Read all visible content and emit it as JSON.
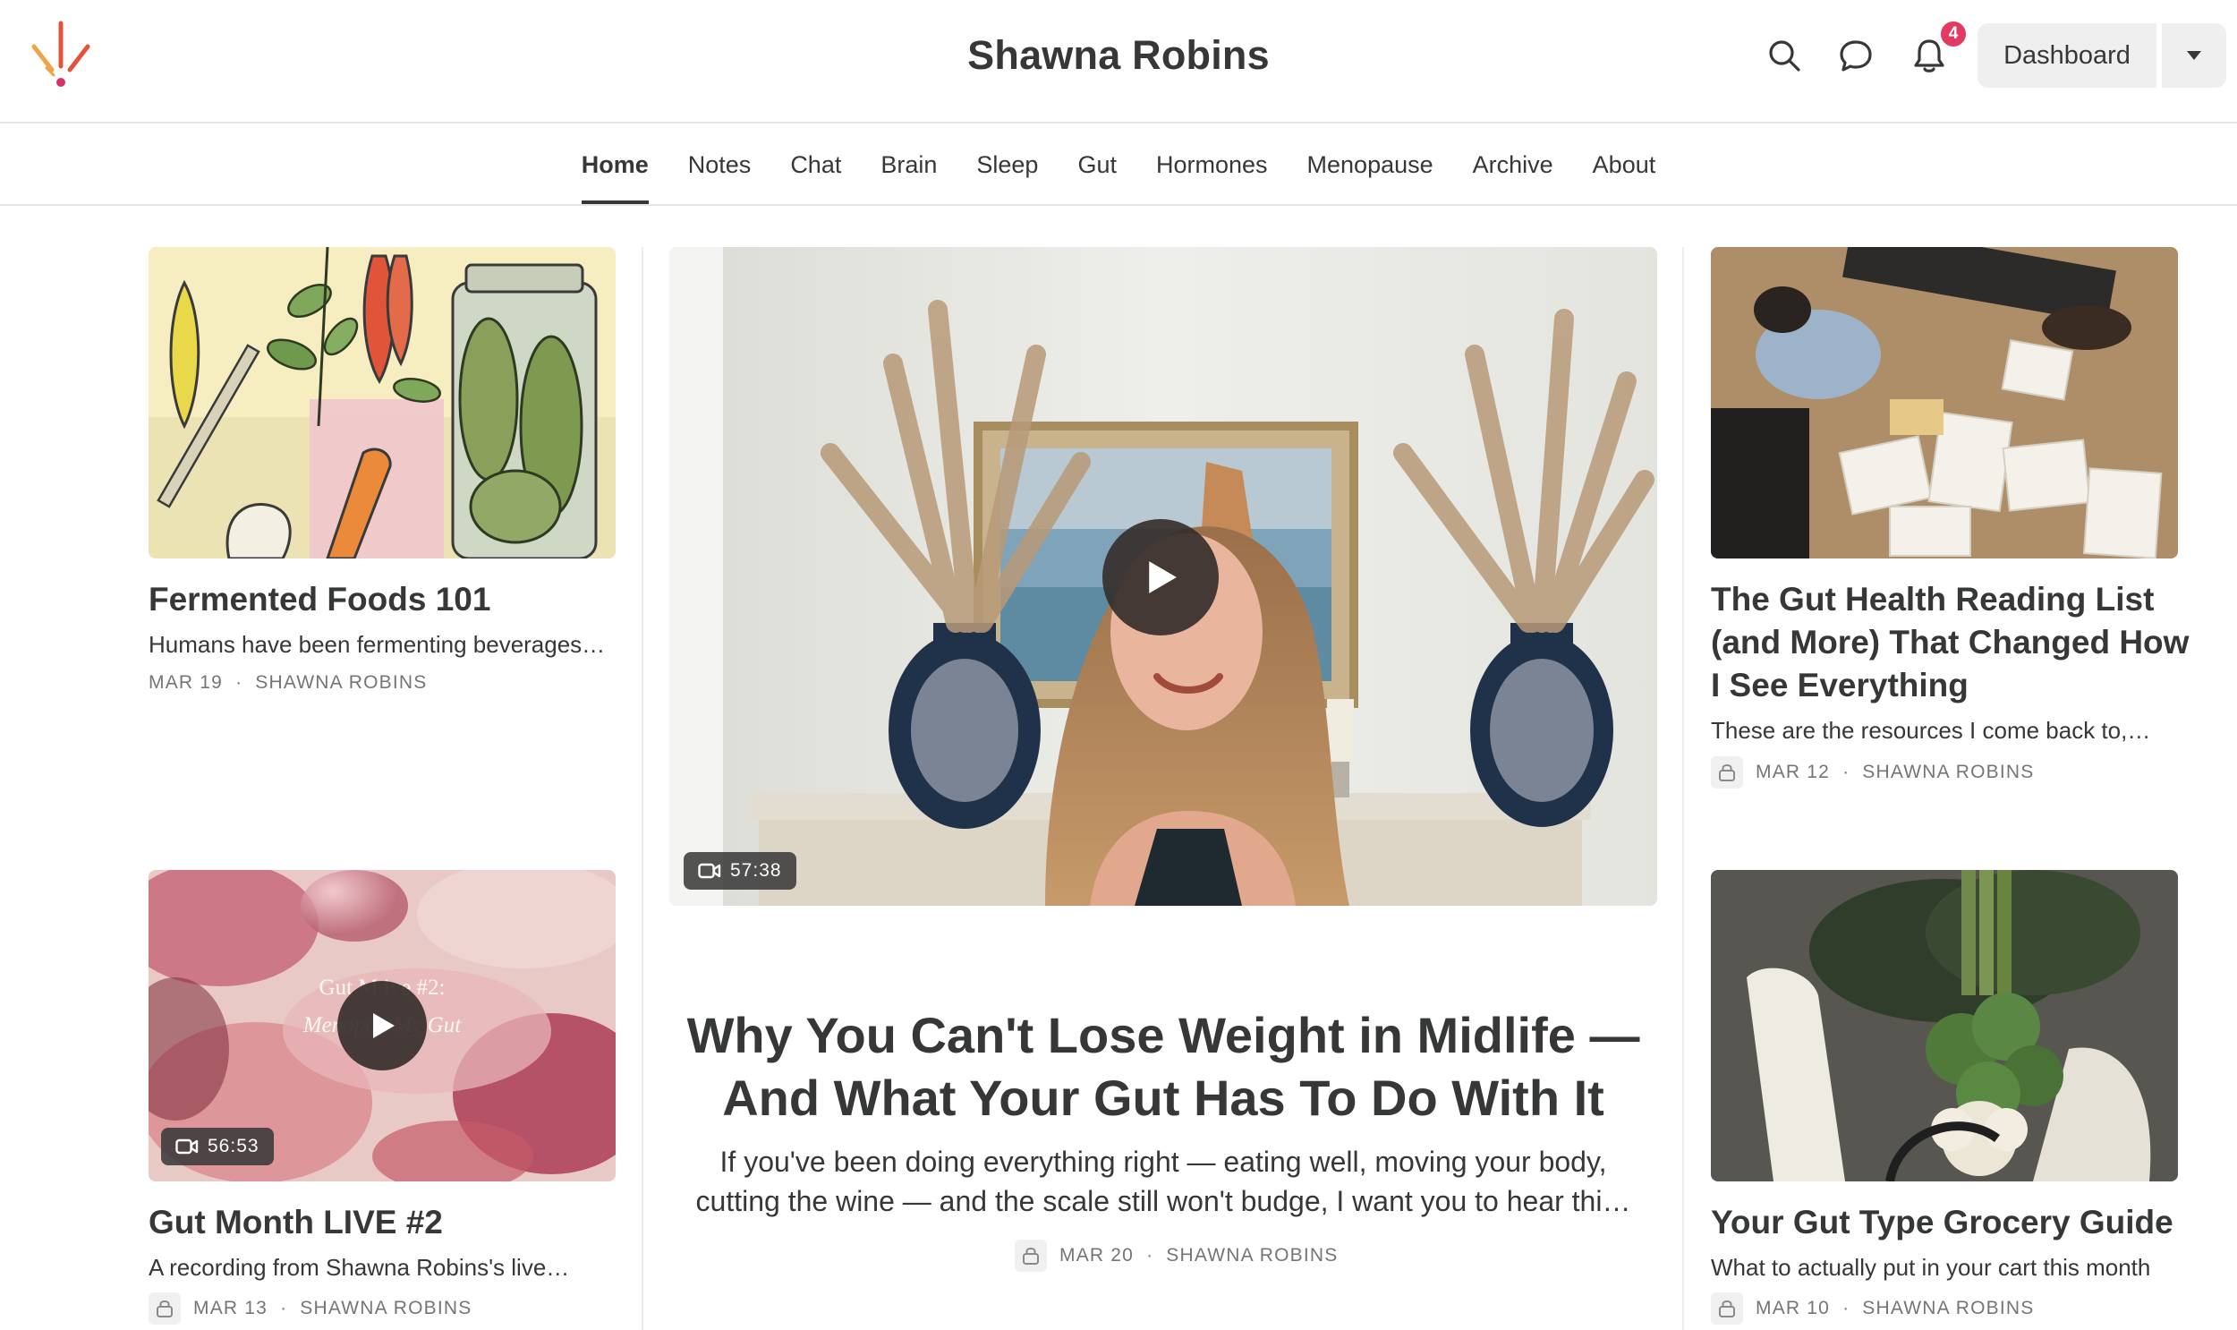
{
  "header": {
    "site_title": "Shawna Robins",
    "notification_count": "4",
    "dashboard_label": "Dashboard",
    "icons": [
      "logo-burst-icon",
      "search-icon",
      "chat-bubble-icon",
      "bell-icon",
      "caret-down-icon"
    ],
    "accent_colors": {
      "badge": "#e13a63",
      "logo_red": "#e4523b",
      "logo_orange": "#f0a24a",
      "logo_pink": "#d6306b"
    }
  },
  "nav": {
    "items": [
      "Home",
      "Notes",
      "Chat",
      "Brain",
      "Sleep",
      "Gut",
      "Hormones",
      "Menopause",
      "Archive",
      "About"
    ],
    "active": "Home"
  },
  "posts": {
    "fermented": {
      "title": "Fermented Foods 101",
      "subtitle": "Humans have been fermenting beverages…",
      "date": "MAR 19",
      "author": "SHAWNA ROBINS"
    },
    "featured": {
      "title": "Why You Can't Lose Weight in Midlife — And What Your Gut Has To Do With It",
      "subtitle": "If you've been doing everything right — eating well, moving your body, cutting the wine — and the scale still won't budge, I want you to hear thi…",
      "date": "MAR 20",
      "author": "SHAWNA ROBINS",
      "duration": "57:38",
      "locked": true
    },
    "reading_list": {
      "title": "The Gut Health Reading List (and More) That Changed How I See Everything",
      "subtitle": "These are the resources I come back to,…",
      "date": "MAR 12",
      "author": "SHAWNA ROBINS",
      "locked": true
    },
    "gut_live": {
      "title": "Gut Month LIVE #2",
      "subtitle": "A recording from Shawna Robins's live…",
      "date": "MAR 13",
      "author": "SHAWNA ROBINS",
      "duration": "56:53",
      "thumb_text_line1": "Gut M      ive #2:",
      "thumb_text_line2": "Menopau        My Gut",
      "locked": true
    },
    "grocery": {
      "title": "Your Gut Type Grocery Guide",
      "subtitle": "What to actually put in your cart this month",
      "date": "MAR 10",
      "author": "SHAWNA ROBINS",
      "locked": true
    }
  },
  "separator": "·"
}
